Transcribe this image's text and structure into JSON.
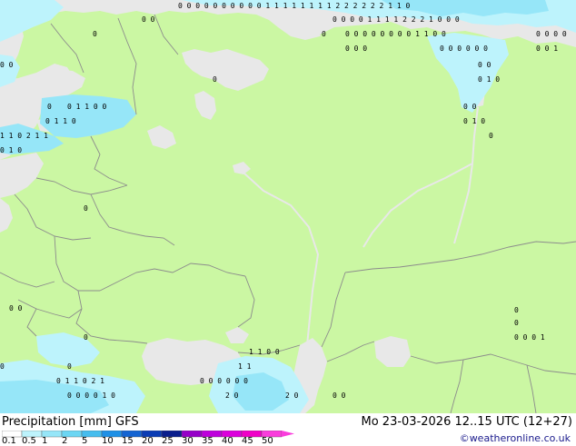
{
  "footer": {
    "title": "Precipitation [mm]  GFS",
    "datetime": "Mo 23-03-2026 12..15 UTC (12+27)",
    "credit": "©weatheronline.co.uk"
  },
  "legend": {
    "ticks": [
      "0.1",
      "0.5",
      "1",
      "2",
      "5",
      "10",
      "15",
      "20",
      "25",
      "30",
      "35",
      "40",
      "45",
      "50"
    ],
    "colors": [
      "#ffffff",
      "#bdf3fc",
      "#96e6f8",
      "#6cd6f3",
      "#46bdee",
      "#1e90e6",
      "#1464d2",
      "#0a3cb4",
      "#0a1e8c",
      "#9600c8",
      "#be00dc",
      "#dc00dc",
      "#f000c8",
      "#fa3cdc"
    ]
  },
  "map_colors": {
    "land": "#cbf7a3",
    "sea": "#e8e8e8",
    "precip_light": "#bdf3fc",
    "precip_mid": "#96e6f8",
    "border": "#8c8c8c"
  },
  "precip_labels": [
    {
      "text": "0 0 0 0 0 0 0 0 0 0 1 1 1 1 1 1 1 1 2 2 2 2 2 2 1 1 0"
    },
    {
      "text": "0 0"
    },
    {
      "text": "0 0 0 0 1 1 1 1 2 2 2 1 0 0 0"
    },
    {
      "text": "0"
    },
    {
      "text": "0"
    },
    {
      "text": "0 0 0 0 0 0 0 0 1 1 0 0"
    },
    {
      "text": "0 0 0 0"
    },
    {
      "text": "0 0 0"
    },
    {
      "text": "0 0 0 0 0 0"
    },
    {
      "text": "0 0 1"
    },
    {
      "text": "0"
    },
    {
      "text": "0 0"
    },
    {
      "text": "0 0"
    },
    {
      "text": "0 1 0"
    },
    {
      "text": "0 1 1 0 0"
    },
    {
      "text": "0"
    },
    {
      "text": "0 0"
    },
    {
      "text": "0 1 1 0"
    },
    {
      "text": "0 1 0"
    },
    {
      "text": "1 1 0 2 1 1"
    },
    {
      "text": "0"
    },
    {
      "text": "0 1 0"
    },
    {
      "text": "0"
    },
    {
      "text": "0"
    },
    {
      "text": "0 0"
    },
    {
      "text": "0"
    },
    {
      "text": "0"
    },
    {
      "text": "0 0 0 1"
    },
    {
      "text": "1 1 0 0"
    },
    {
      "text": "1 1"
    },
    {
      "text": "0"
    },
    {
      "text": "0 1 1 0 2 1"
    },
    {
      "text": "0 0 0 0 0 0"
    },
    {
      "text": "0 0 0 0 1 0"
    },
    {
      "text": "2 0"
    },
    {
      "text": "2 0"
    },
    {
      "text": "0 0"
    },
    {
      "text": "0"
    }
  ]
}
